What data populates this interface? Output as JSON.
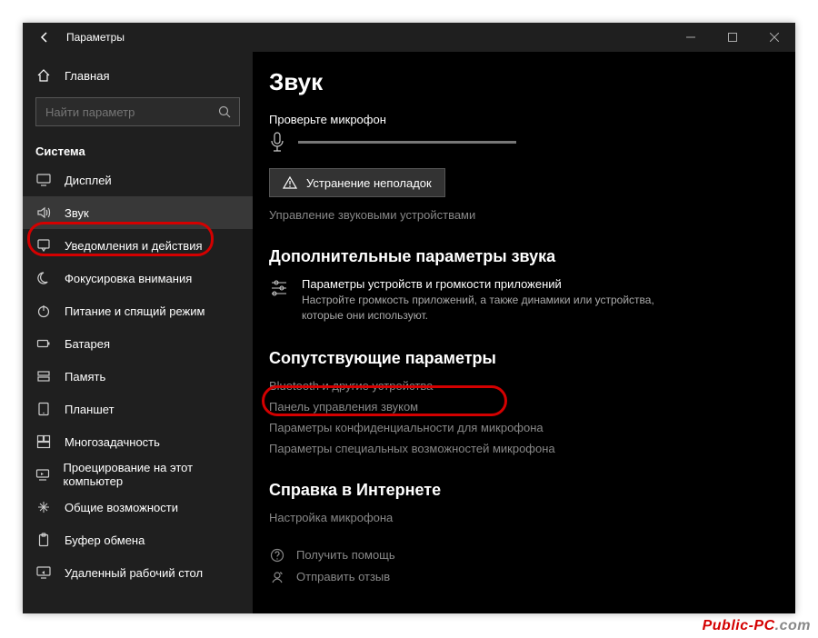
{
  "titlebar": {
    "title": "Параметры"
  },
  "sidebar": {
    "home": "Главная",
    "search_placeholder": "Найти параметр",
    "section": "Система",
    "items": [
      {
        "icon": "display-icon",
        "label": "Дисплей"
      },
      {
        "icon": "sound-icon",
        "label": "Звук",
        "selected": true
      },
      {
        "icon": "notifications-icon",
        "label": "Уведомления и действия"
      },
      {
        "icon": "focus-icon",
        "label": "Фокусировка внимания"
      },
      {
        "icon": "power-icon",
        "label": "Питание и спящий режим"
      },
      {
        "icon": "battery-icon",
        "label": "Батарея"
      },
      {
        "icon": "storage-icon",
        "label": "Память"
      },
      {
        "icon": "tablet-icon",
        "label": "Планшет"
      },
      {
        "icon": "multitask-icon",
        "label": "Многозадачность"
      },
      {
        "icon": "project-icon",
        "label": "Проецирование на этот компьютер"
      },
      {
        "icon": "shared-icon",
        "label": "Общие возможности"
      },
      {
        "icon": "clipboard-icon",
        "label": "Буфер обмена"
      },
      {
        "icon": "remote-icon",
        "label": "Удаленный рабочий стол"
      }
    ]
  },
  "content": {
    "heading": "Звук",
    "mic_test_label": "Проверьте микрофон",
    "troubleshoot_button": "Устранение неполадок",
    "manage_devices_link": "Управление звуковыми устройствами",
    "advanced_heading": "Дополнительные параметры звука",
    "app_volume": {
      "title": "Параметры устройств и громкости приложений",
      "desc": "Настройте громкость приложений, а также динамики или устройства, которые они используют."
    },
    "related_heading": "Сопутствующие параметры",
    "related_links": [
      "Bluetooth и другие устройства",
      "Панель управления звуком",
      "Параметры конфиденциальности для микрофона",
      "Параметры специальных возможностей микрофона"
    ],
    "webhelp_heading": "Справка в Интернете",
    "webhelp_link": "Настройка микрофона",
    "get_help": "Получить помощь",
    "feedback": "Отправить отзыв"
  },
  "watermark": {
    "part1": "Public-PC",
    "part2": ".com"
  }
}
